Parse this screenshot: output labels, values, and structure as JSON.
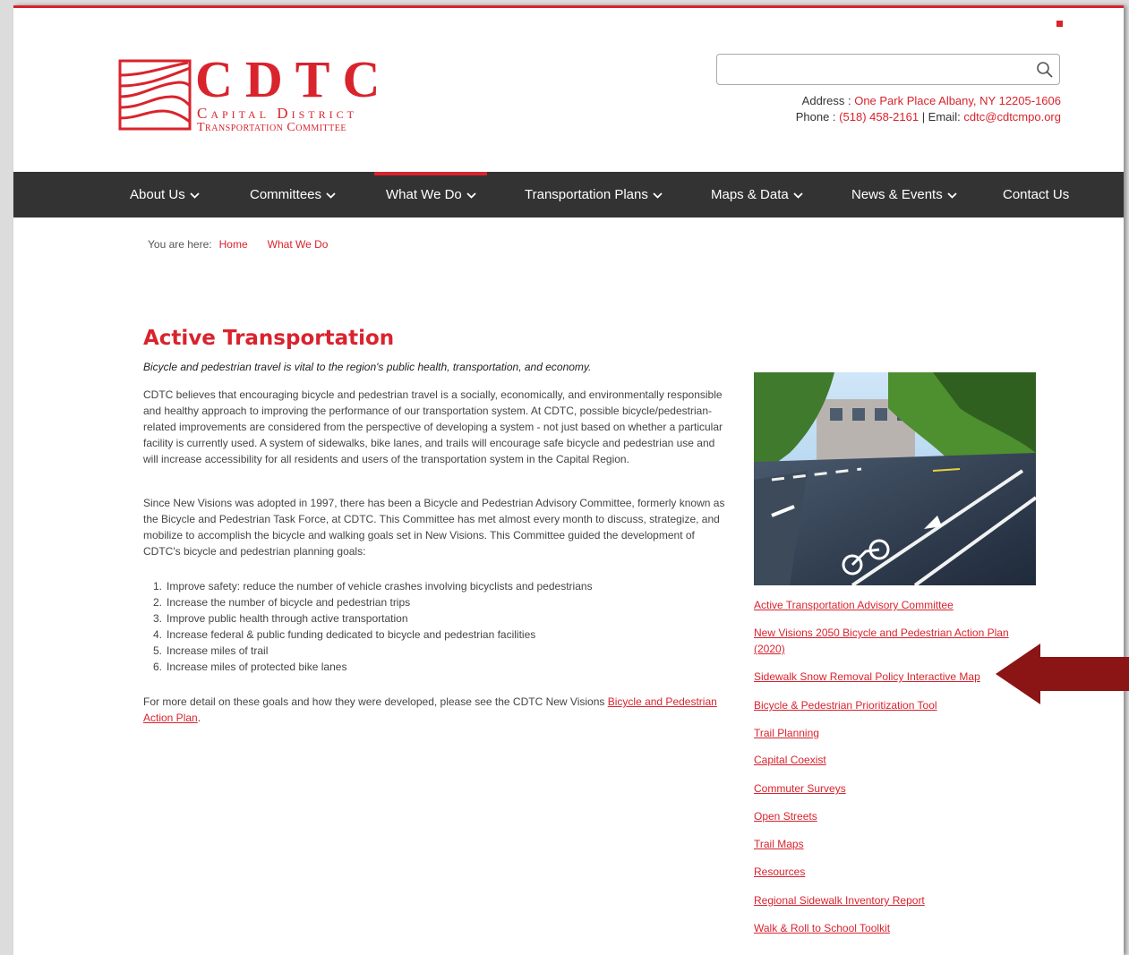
{
  "logo": {
    "letters": "CDTC",
    "line1": "Capital District",
    "line2": "Transportation Committee"
  },
  "search": {
    "placeholder": "",
    "icon": "search-icon"
  },
  "contact": {
    "address_label": "Address : ",
    "address_value": "One Park Place Albany, NY 12205-1606",
    "phone_label": "Phone : ",
    "phone_value": "(518) 458-2161",
    "email_label": " | Email: ",
    "email_value": "cdtc@cdtcmpo.org"
  },
  "nav": {
    "items": [
      {
        "label": "About Us"
      },
      {
        "label": "Committees"
      },
      {
        "label": "What We Do"
      },
      {
        "label": "Transportation Plans"
      },
      {
        "label": "Maps & Data"
      },
      {
        "label": "News & Events"
      },
      {
        "label": "Contact Us"
      }
    ]
  },
  "breadcrumb": {
    "prefix": "You are here:",
    "items": [
      "Home",
      "What We Do"
    ]
  },
  "main": {
    "title": "Active Transportation",
    "subtitle": "Bicycle and pedestrian travel is vital to the region's public health, transportation, and economy.",
    "para1": "CDTC believes that encouraging bicycle and pedestrian travel is a socially, economically, and environmentally responsible and healthy approach to improving the performance of our transportation system. At CDTC, possible bicycle/pedestrian-related improvements are considered from the perspective of developing a system - not just based on whether a particular facility is currently used. A system of sidewalks, bike lanes, and trails will encourage safe bicycle and pedestrian use and will increase accessibility for all residents and users of the transportation system in the Capital Region.",
    "para2": "Since New Visions was adopted in 1997, there has been a Bicycle and Pedestrian Advisory Committee, formerly known as the Bicycle and Pedestrian Task Force, at CDTC. This Committee has met almost every month to discuss, strategize, and mobilize to accomplish the bicycle and walking goals set in New Visions. This Committee guided the development of CDTC's bicycle and pedestrian planning goals:",
    "goals": [
      {
        "num": "1.",
        "text": "Improve safety: reduce the number of vehicle crashes involving bicyclists and pedestrians"
      },
      {
        "num": "2.",
        "text": "Increase the number of bicycle and pedestrian trips"
      },
      {
        "num": "3.",
        "text": "Improve public health through active transportation"
      },
      {
        "num": "4.",
        "text": "Increase federal & public funding dedicated to bicycle and pedestrian facilities"
      },
      {
        "num": "5.",
        "text": "Increase miles of trail"
      },
      {
        "num": "6.",
        "text": "Increase miles of protected bike lanes"
      }
    ],
    "para3_text": "For more detail on these goals and how they were developed, please see the CDTC New Visions ",
    "para3_link": "Bicycle and Pedestrian Action Plan",
    "para3_end": "."
  },
  "sidebar": {
    "links": [
      "Active Transportation Advisory Committee",
      "New Visions 2050 Bicycle and Pedestrian Action Plan (2020)",
      "Sidewalk Snow Removal Policy Interactive Map",
      "Bicycle & Pedestrian Prioritization Tool",
      "Trail Planning",
      "Capital Coexist",
      "Commuter Surveys",
      "Open Streets",
      "Trail Maps",
      "Resources",
      "Regional Sidewalk Inventory Report",
      "Walk & Roll to School Toolkit"
    ]
  },
  "colors": {
    "brand_red": "#d9232d",
    "nav_bg": "#333333",
    "arrow": "#8b1414"
  }
}
